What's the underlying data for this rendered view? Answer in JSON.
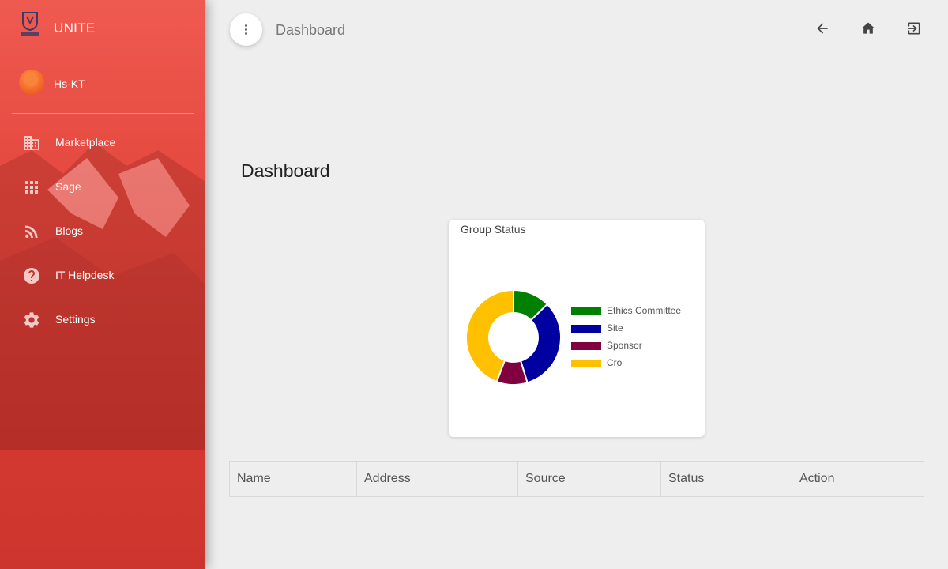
{
  "app": {
    "name": "UNITE",
    "logo_text": "UNITE"
  },
  "user": {
    "name": "Hs-KT"
  },
  "sidebar": {
    "items": [
      {
        "label": "Marketplace",
        "icon": "building-icon"
      },
      {
        "label": "Sage",
        "icon": "apps-grid-icon"
      },
      {
        "label": "Blogs",
        "icon": "rss-icon"
      },
      {
        "label": "IT Helpdesk",
        "icon": "help-circle-icon"
      },
      {
        "label": "Settings",
        "icon": "gear-icon"
      }
    ]
  },
  "topbar": {
    "title": "Dashboard",
    "icons": [
      "back-arrow-icon",
      "home-icon",
      "logout-icon"
    ]
  },
  "page": {
    "title": "Dashboard"
  },
  "card": {
    "title": "Group Status"
  },
  "chart_data": {
    "type": "pie",
    "subtype": "donut",
    "title": "Group Status",
    "legend_position": "right",
    "categories": [
      "Ethics Committee",
      "Site",
      "Sponsor",
      "Cro"
    ],
    "values": [
      1.2,
      3.1,
      1.0,
      4.2
    ],
    "colors": [
      "#008000",
      "#0000a0",
      "#800040",
      "#ffc000"
    ]
  },
  "table": {
    "columns": [
      "Name",
      "Address",
      "Source",
      "Status",
      "Action"
    ]
  }
}
